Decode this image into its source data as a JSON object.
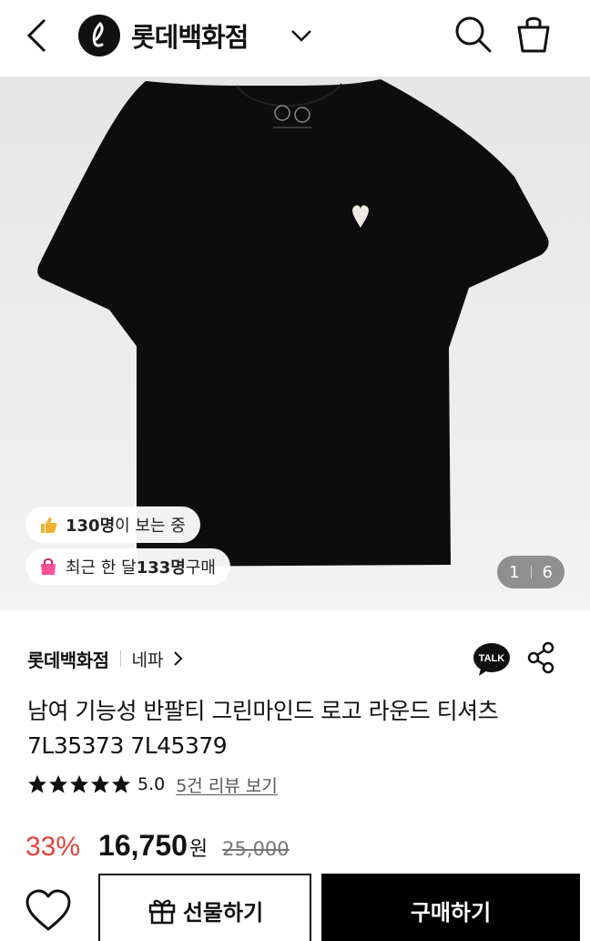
{
  "header": {
    "brand_name": "롯데백화점",
    "logo_letter": "ℓ"
  },
  "hero": {
    "viewers_count": "130명",
    "viewers_suffix": "이 보는 중",
    "buyers_prefix": "최근 한 달 ",
    "buyers_count": "133명",
    "buyers_suffix": " 구매",
    "pager_current": "1",
    "pager_total": "6"
  },
  "product": {
    "store_name": "롯데백화점",
    "store_sub": "네파",
    "talk_label": "TALK",
    "title": "남여 기능성 반팔티 그린마인드 로고 라운드 티셔츠 7L35373 7L45379",
    "rating_stars": 5,
    "score": "5.0",
    "reviews_link": "5건 리뷰 보기",
    "discount": "33%",
    "price": "16,750",
    "currency": "원",
    "original_price": "25,000"
  },
  "actions": {
    "gift_label": "선물하기",
    "buy_label": "구매하기"
  },
  "colors": {
    "discount": "#e0443a",
    "buy_button": "#000000",
    "viewers_emoji": "#f2b12f",
    "buyers_emoji": "#ff4f9a"
  }
}
